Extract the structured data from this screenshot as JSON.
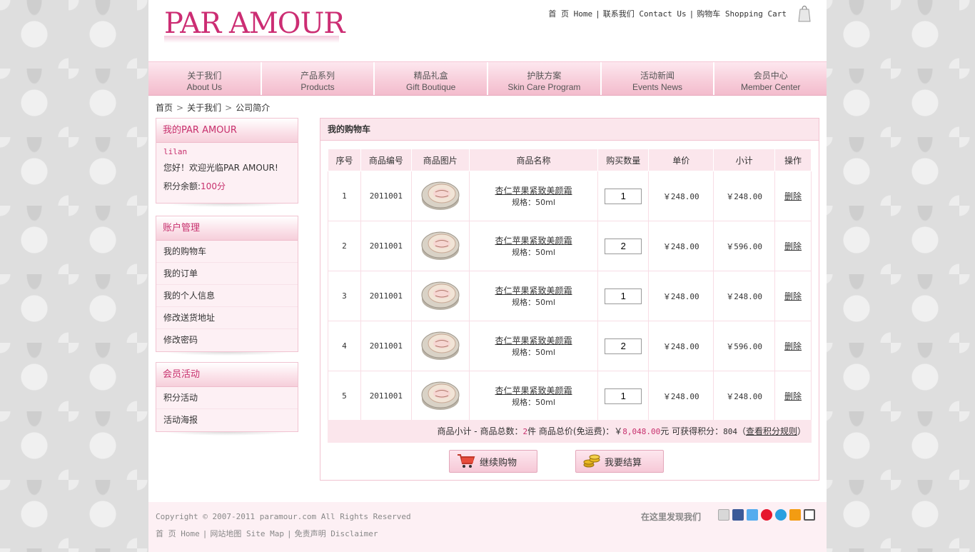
{
  "header": {
    "logo": "PAR AMOUR",
    "links": [
      "首 页 Home",
      "联系我们 Contact Us",
      "购物车 Shopping Cart"
    ],
    "separator": "|"
  },
  "nav": [
    {
      "cn": "关于我们",
      "en": "About Us"
    },
    {
      "cn": "产品系列",
      "en": "Products"
    },
    {
      "cn": "精品礼盒",
      "en": "Gift Boutique"
    },
    {
      "cn": "护肤方案",
      "en": "Skin Care Program"
    },
    {
      "cn": "活动新闻",
      "en": "Events News"
    },
    {
      "cn": "会员中心",
      "en": "Member Center"
    }
  ],
  "breadcrumb": [
    "首页",
    "关于我们",
    "公司简介"
  ],
  "sidebar": {
    "my_box": {
      "title": "我的PAR AMOUR",
      "username": "lilan",
      "greeting": "您好！欢迎光临PAR AMOUR!",
      "points_label": "积分余额:",
      "points_value": "100分"
    },
    "account": {
      "title": "账户管理",
      "items": [
        "我的购物车",
        "我的订单",
        "我的个人信息",
        "修改送货地址",
        "修改密码"
      ]
    },
    "activity": {
      "title": "会员活动",
      "items": [
        "积分活动",
        "活动海报"
      ]
    }
  },
  "cart": {
    "title": "我的购物车",
    "columns": [
      "序号",
      "商品编号",
      "商品图片",
      "商品名称",
      "购买数量",
      "单价",
      "小计",
      "操作"
    ],
    "rows": [
      {
        "index": "1",
        "code": "2011001",
        "name": "杏仁苹果紧致美颜霜",
        "spec": "规格：50ml",
        "qty": "1",
        "price": "￥248.00",
        "subtotal": "￥248.00",
        "action": "删除"
      },
      {
        "index": "2",
        "code": "2011001",
        "name": "杏仁苹果紧致美颜霜",
        "spec": "规格：50ml",
        "qty": "2",
        "price": "￥248.00",
        "subtotal": "￥596.00",
        "action": "删除"
      },
      {
        "index": "3",
        "code": "2011001",
        "name": "杏仁苹果紧致美颜霜",
        "spec": "规格：50ml",
        "qty": "1",
        "price": "￥248.00",
        "subtotal": "￥248.00",
        "action": "删除"
      },
      {
        "index": "4",
        "code": "2011001",
        "name": "杏仁苹果紧致美颜霜",
        "spec": "规格：50ml",
        "qty": "2",
        "price": "￥248.00",
        "subtotal": "￥596.00",
        "action": "删除"
      },
      {
        "index": "5",
        "code": "2011001",
        "name": "杏仁苹果紧致美颜霜",
        "spec": "规格：50ml",
        "qty": "1",
        "price": "￥248.00",
        "subtotal": "￥248.00",
        "action": "删除"
      }
    ],
    "summary": {
      "prefix": "商品小计 - 商品总数：",
      "count": "2",
      "count_unit": "件 商品总价(免运费)：￥",
      "total": "8,048.00",
      "total_unit": "元 可获得积分：",
      "points": "804",
      "link_open": "（",
      "link": "查看积分规则",
      "link_close": "）"
    },
    "buttons": {
      "continue": "继续购物",
      "checkout": "我要结算"
    }
  },
  "footer": {
    "copyright": "Copyright © 2007-2011 paramour.com All Rights Reserved",
    "links": [
      "首 页 Home",
      "网站地图 Site Map",
      "免责声明 Disclaimer"
    ],
    "find_us": "在这里发现我们"
  },
  "colors": {
    "brand_pink": "#cc2d73",
    "panel_pink": "#fbe6ec",
    "border_pink": "#f1c3d1"
  }
}
